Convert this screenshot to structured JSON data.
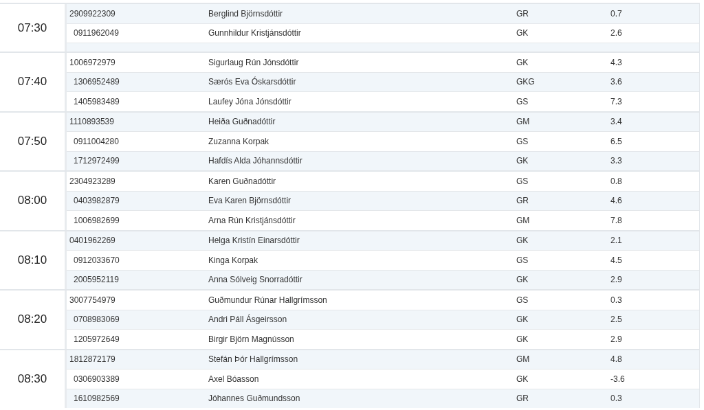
{
  "groups": [
    {
      "time": "07:30",
      "rows": [
        {
          "kind": "player",
          "id": "2909922309",
          "name": "Berglind Björnsdóttir",
          "club": "GR",
          "handicap": "0.7"
        },
        {
          "kind": "player",
          "id": "0911962049",
          "name": "Gunnhildur Kristjánsdóttir",
          "club": "GK",
          "handicap": "2.6"
        },
        {
          "kind": "blank"
        }
      ]
    },
    {
      "time": "07:40",
      "rows": [
        {
          "kind": "player",
          "id": "1006972979",
          "name": "Sigurlaug Rún Jónsdóttir",
          "club": "GK",
          "handicap": "4.3"
        },
        {
          "kind": "player",
          "id": "1306952489",
          "name": "Særós Eva Óskarsdóttir",
          "club": "GKG",
          "handicap": "3.6"
        },
        {
          "kind": "player",
          "id": "1405983489",
          "name": "Laufey Jóna Jónsdóttir",
          "club": "GS",
          "handicap": "7.3"
        }
      ]
    },
    {
      "time": "07:50",
      "rows": [
        {
          "kind": "player",
          "id": "1110893539",
          "name": "Heiða Guðnadóttir",
          "club": "GM",
          "handicap": "3.4"
        },
        {
          "kind": "player",
          "id": "0911004280",
          "name": "Zuzanna Korpak",
          "club": "GS",
          "handicap": "6.5"
        },
        {
          "kind": "player",
          "id": "1712972499",
          "name": "Hafdís Alda Jóhannsdóttir",
          "club": "GK",
          "handicap": "3.3"
        }
      ]
    },
    {
      "time": "08:00",
      "rows": [
        {
          "kind": "player",
          "id": "2304923289",
          "name": "Karen Guðnadóttir",
          "club": "GS",
          "handicap": "0.8"
        },
        {
          "kind": "player",
          "id": "0403982879",
          "name": "Eva Karen Björnsdóttir",
          "club": "GR",
          "handicap": "4.6"
        },
        {
          "kind": "player",
          "id": "1006982699",
          "name": "Arna Rún Kristjánsdóttir",
          "club": "GM",
          "handicap": "7.8"
        }
      ]
    },
    {
      "time": "08:10",
      "rows": [
        {
          "kind": "player",
          "id": "0401962269",
          "name": "Helga Kristín Einarsdóttir",
          "club": "GK",
          "handicap": "2.1"
        },
        {
          "kind": "player",
          "id": "0912033670",
          "name": "Kinga Korpak",
          "club": "GS",
          "handicap": "4.5"
        },
        {
          "kind": "player",
          "id": "2005952119",
          "name": "Anna Sólveig Snorradóttir",
          "club": "GK",
          "handicap": "2.9"
        }
      ]
    },
    {
      "time": "08:20",
      "rows": [
        {
          "kind": "player",
          "id": "3007754979",
          "name": "Guðmundur Rúnar Hallgrímsson",
          "club": "GS",
          "handicap": "0.3"
        },
        {
          "kind": "player",
          "id": "0708983069",
          "name": "Andri Páll Ásgeirsson",
          "club": "GK",
          "handicap": "2.5"
        },
        {
          "kind": "player",
          "id": "1205972649",
          "name": "Birgir Björn Magnússon",
          "club": "GK",
          "handicap": "2.9"
        }
      ]
    },
    {
      "time": "08:30",
      "rows": [
        {
          "kind": "player",
          "id": "1812872179",
          "name": "Stefán Þór Hallgrímsson",
          "club": "GM",
          "handicap": "4.8"
        },
        {
          "kind": "player",
          "id": "0306903389",
          "name": "Axel Bóasson",
          "club": "GK",
          "handicap": "-3.6"
        },
        {
          "kind": "player",
          "id": "1610982569",
          "name": "Jóhannes Guðmundsson",
          "club": "GR",
          "handicap": "0.3"
        }
      ]
    }
  ]
}
